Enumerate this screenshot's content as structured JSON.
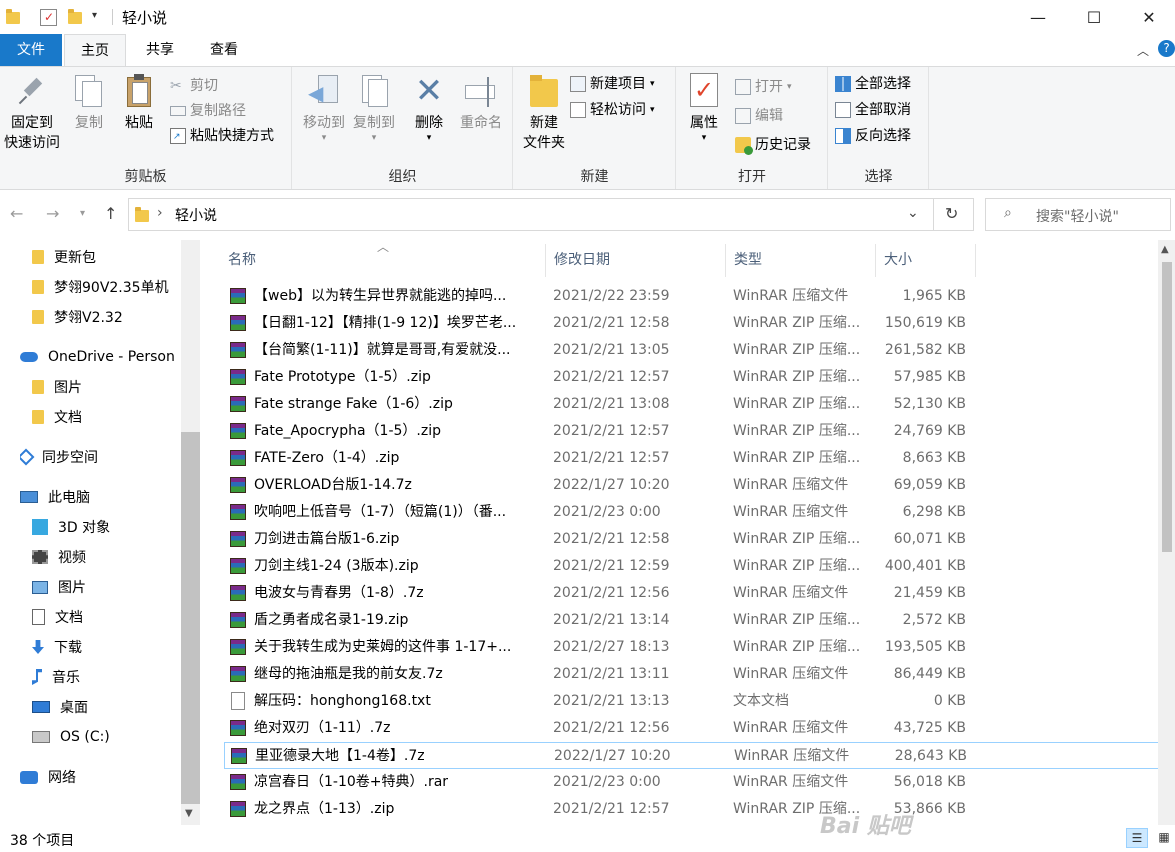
{
  "window": {
    "title": "轻小说",
    "minimize": "—",
    "maximize": "☐",
    "close": "✕"
  },
  "tabs": {
    "file": "文件",
    "home": "主页",
    "share": "共享",
    "view": "查看"
  },
  "ribbon": {
    "clipboard": {
      "label": "剪贴板",
      "pin": [
        "固定到",
        "快速访问"
      ],
      "copy": "复制",
      "paste": "粘贴",
      "cut": "剪切",
      "copy_path": "复制路径",
      "paste_shortcut": "粘贴快捷方式"
    },
    "organize": {
      "label": "组织",
      "move_to": "移动到",
      "copy_to": "复制到",
      "delete": "删除",
      "rename": "重命名"
    },
    "new": {
      "label": "新建",
      "new_folder": [
        "新建",
        "文件夹"
      ],
      "new_item": "新建项目",
      "easy_access": "轻松访问"
    },
    "open": {
      "label": "打开",
      "properties": "属性",
      "open": "打开",
      "edit": "编辑",
      "history": "历史记录"
    },
    "select": {
      "label": "选择",
      "select_all": "全部选择",
      "select_none": "全部取消",
      "invert": "反向选择"
    }
  },
  "address": {
    "path": "轻小说",
    "search_placeholder": "搜索\"轻小说\""
  },
  "nav": {
    "items": [
      {
        "label": "更新包",
        "icon": "folder-icon"
      },
      {
        "label": "梦翎90V2.35单机",
        "icon": "folder-icon"
      },
      {
        "label": "梦翎V2.32",
        "icon": "folder-icon"
      },
      {
        "label": "OneDrive - Person",
        "icon": "cloud-icon"
      },
      {
        "label": "图片",
        "icon": "folder-icon"
      },
      {
        "label": "文档",
        "icon": "folder-icon"
      },
      {
        "label": "同步空间",
        "icon": "sync-icon"
      },
      {
        "label": "此电脑",
        "icon": "computer-icon"
      },
      {
        "label": "3D 对象",
        "icon": "cube-icon"
      },
      {
        "label": "视频",
        "icon": "video-icon"
      },
      {
        "label": "图片",
        "icon": "picture-icon"
      },
      {
        "label": "文档",
        "icon": "document-icon"
      },
      {
        "label": "下载",
        "icon": "download-icon"
      },
      {
        "label": "音乐",
        "icon": "music-icon"
      },
      {
        "label": "桌面",
        "icon": "desktop-icon"
      },
      {
        "label": "OS (C:)",
        "icon": "drive-icon"
      },
      {
        "label": "网络",
        "icon": "network-icon"
      }
    ]
  },
  "columns": {
    "name": "名称",
    "date": "修改日期",
    "type": "类型",
    "size": "大小"
  },
  "files": [
    {
      "name": "【web】以为转生异世界就能逃的掉吗...",
      "date": "2021/2/22 23:59",
      "type": "WinRAR 压缩文件",
      "size": "1,965 KB",
      "icon": "rar"
    },
    {
      "name": "【日翻1-12】【精排(1-9 12)】埃罗芒老...",
      "date": "2021/2/21 12:58",
      "type": "WinRAR ZIP 压缩...",
      "size": "150,619 KB",
      "icon": "rar"
    },
    {
      "name": "【台简繁(1-11)】就算是哥哥,有爱就没...",
      "date": "2021/2/21 13:05",
      "type": "WinRAR ZIP 压缩...",
      "size": "261,582 KB",
      "icon": "rar"
    },
    {
      "name": "Fate Prototype（1-5）.zip",
      "date": "2021/2/21 12:57",
      "type": "WinRAR ZIP 压缩...",
      "size": "57,985 KB",
      "icon": "rar"
    },
    {
      "name": "Fate strange Fake（1-6）.zip",
      "date": "2021/2/21 13:08",
      "type": "WinRAR ZIP 压缩...",
      "size": "52,130 KB",
      "icon": "rar"
    },
    {
      "name": "Fate_Apocrypha（1-5）.zip",
      "date": "2021/2/21 12:57",
      "type": "WinRAR ZIP 压缩...",
      "size": "24,769 KB",
      "icon": "rar"
    },
    {
      "name": "FATE-Zero（1-4）.zip",
      "date": "2021/2/21 12:57",
      "type": "WinRAR ZIP 压缩...",
      "size": "8,663 KB",
      "icon": "rar"
    },
    {
      "name": "OVERLOAD台版1-14.7z",
      "date": "2022/1/27 10:20",
      "type": "WinRAR 压缩文件",
      "size": "69,059 KB",
      "icon": "rar"
    },
    {
      "name": "吹响吧上低音号（1-7）（短篇(1)）（番...",
      "date": "2021/2/23 0:00",
      "type": "WinRAR 压缩文件",
      "size": "6,298 KB",
      "icon": "rar"
    },
    {
      "name": "刀剑进击篇台版1-6.zip",
      "date": "2021/2/21 12:58",
      "type": "WinRAR ZIP 压缩...",
      "size": "60,071 KB",
      "icon": "rar"
    },
    {
      "name": "刀剑主线1-24 (3版本).zip",
      "date": "2021/2/21 12:59",
      "type": "WinRAR ZIP 压缩...",
      "size": "400,401 KB",
      "icon": "rar"
    },
    {
      "name": "电波女与青春男（1-8）.7z",
      "date": "2021/2/21 12:56",
      "type": "WinRAR 压缩文件",
      "size": "21,459 KB",
      "icon": "rar"
    },
    {
      "name": "盾之勇者成名录1-19.zip",
      "date": "2021/2/21 13:14",
      "type": "WinRAR ZIP 压缩...",
      "size": "2,572 KB",
      "icon": "rar"
    },
    {
      "name": "关于我转生成为史莱姆的这件事 1-17+...",
      "date": "2021/2/27 18:13",
      "type": "WinRAR ZIP 压缩...",
      "size": "193,505 KB",
      "icon": "rar"
    },
    {
      "name": "继母的拖油瓶是我的前女友.7z",
      "date": "2021/2/21 13:11",
      "type": "WinRAR 压缩文件",
      "size": "86,449 KB",
      "icon": "rar"
    },
    {
      "name": "解压码：honghong168.txt",
      "date": "2021/2/21 13:13",
      "type": "文本文档",
      "size": "0 KB",
      "icon": "txt"
    },
    {
      "name": "绝对双刃（1-11）.7z",
      "date": "2021/2/21 12:56",
      "type": "WinRAR 压缩文件",
      "size": "43,725 KB",
      "icon": "rar"
    },
    {
      "name": "里亚德录大地【1-4卷】.7z",
      "date": "2022/1/27 10:20",
      "type": "WinRAR 压缩文件",
      "size": "28,643 KB",
      "icon": "rar"
    },
    {
      "name": "凉宫春日（1-10卷+特典）.rar",
      "date": "2021/2/23 0:00",
      "type": "WinRAR 压缩文件",
      "size": "56,018 KB",
      "icon": "rar"
    },
    {
      "name": "龙之界点（1-13）.zip",
      "date": "2021/2/21 12:57",
      "type": "WinRAR ZIP 压缩...",
      "size": "53,866 KB",
      "icon": "rar"
    }
  ],
  "status": {
    "count": "38 个项目"
  },
  "watermark": "Bai 贴吧"
}
